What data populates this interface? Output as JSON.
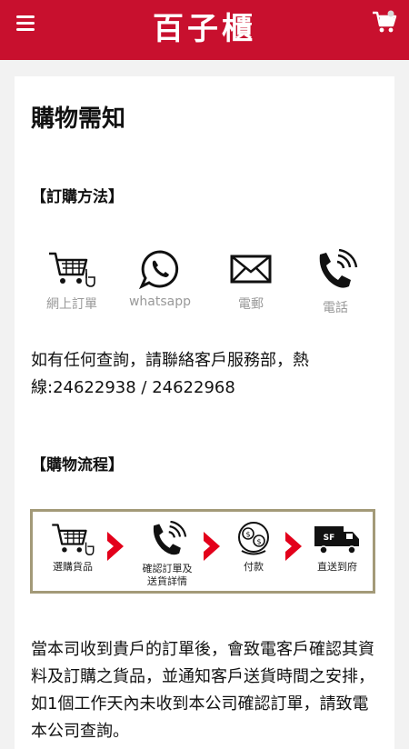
{
  "header": {
    "logo": "百子櫃",
    "menu_icon": "hamburger-menu-icon",
    "cart_icon": "shopping-cart-icon",
    "brand_color": "#c8102e"
  },
  "page": {
    "title": "購物需知",
    "order_methods_title": "【訂購方法】",
    "methods": [
      {
        "label": "網上訂單",
        "icon": "cart-icon"
      },
      {
        "label": "whatsapp",
        "icon": "whatsapp-icon"
      },
      {
        "label": "電郵",
        "icon": "mail-icon"
      },
      {
        "label": "電話",
        "icon": "phone-icon"
      }
    ],
    "contact_text": "如有任何查詢，請聯絡客戶服務部，熱線:24622938 / 24622968",
    "flow_title": "【購物流程】",
    "flow_steps": [
      {
        "label": "選購貨品",
        "icon": "cart-icon"
      },
      {
        "label": "確認訂單及\n送貨詳情",
        "icon": "phone-icon"
      },
      {
        "label": "付款",
        "icon": "payment-icon"
      },
      {
        "label": "直送到府",
        "icon": "delivery-truck-icon"
      }
    ],
    "order_text": "當本司收到貴戶的訂單後，會致電客戶確認其資料及訂購之貨品，並通知客戶送貨時間之安排，如1個工作天內未收到本公司確認訂單，請致電本公司查詢。"
  }
}
